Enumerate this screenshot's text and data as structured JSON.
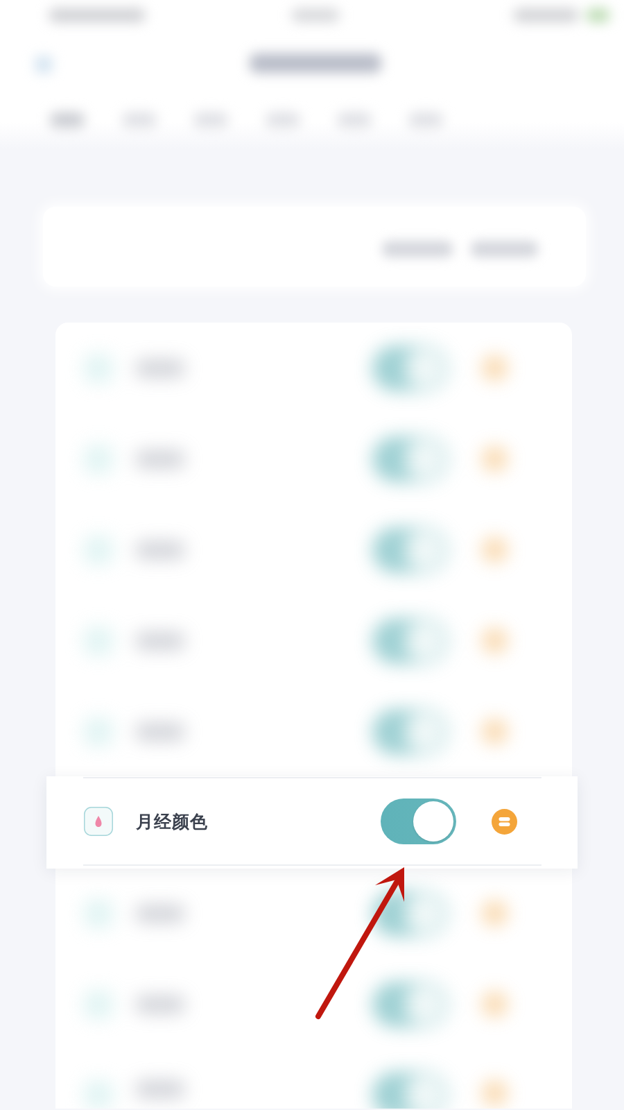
{
  "list": {
    "rows": [
      {
        "kind": "blurred",
        "on": true
      },
      {
        "kind": "blurred",
        "on": true
      },
      {
        "kind": "blurred",
        "on": true
      },
      {
        "kind": "blurred",
        "on": true
      },
      {
        "kind": "blurred",
        "on": true
      },
      {
        "kind": "focused",
        "label": "月经颜色",
        "on": true
      },
      {
        "kind": "blurred",
        "on": true
      },
      {
        "kind": "blurred",
        "on": true
      },
      {
        "kind": "blurred",
        "on": true
      }
    ]
  }
}
